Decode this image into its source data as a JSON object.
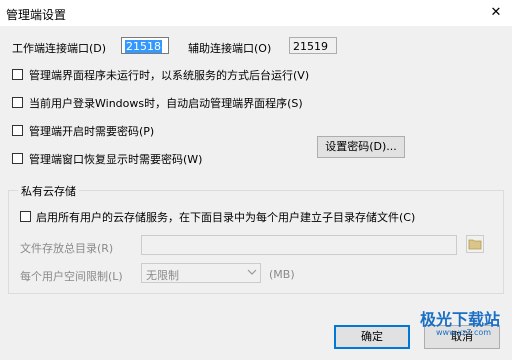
{
  "window": {
    "title": "管理端设置",
    "close_glyph": "✕"
  },
  "ports": {
    "worker_label": "工作端连接端口(D)",
    "worker_value": "21518",
    "aux_label": "辅助连接端口(O)",
    "aux_value": "21519"
  },
  "options": [
    {
      "label": "管理端界面程序未运行时，以系统服务的方式后台运行(V)",
      "checked": false
    },
    {
      "label": "当前用户登录Windows时，自动启动管理端界面程序(S)",
      "checked": false
    },
    {
      "label": "管理端开启时需要密码(P)",
      "checked": false
    },
    {
      "label": "管理端窗口恢复显示时需要密码(W)",
      "checked": false
    }
  ],
  "set_password_button": "设置密码(D)...",
  "private_cloud": {
    "group_title": "私有云存储",
    "enable_label": "启用所有用户的云存储服务，在下面目录中为每个用户建立子目录存储文件(C)",
    "enable_checked": false,
    "dir_label": "文件存放总目录(R)",
    "dir_value": "",
    "limit_label": "每个用户空间限制(L)",
    "limit_value": "无限制",
    "limit_unit": "(MB)"
  },
  "footer": {
    "ok_label": "确定",
    "cancel_label": "取消"
  },
  "watermark": {
    "text": "极光下载站",
    "url": "www.xz7.com"
  },
  "icons": {
    "folder": "folder-icon",
    "dropdown": "chevron-down-icon",
    "close": "close-icon"
  }
}
